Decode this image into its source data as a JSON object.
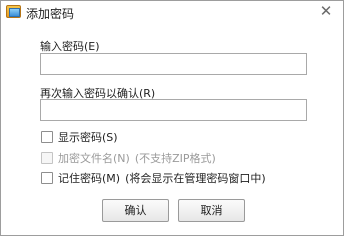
{
  "dialog": {
    "title": "添加密码",
    "close_glyph": "✕"
  },
  "form": {
    "password_label": "输入密码(E)",
    "password_value": "",
    "confirm_label": "再次输入密码以确认(R)",
    "confirm_value": "",
    "options": {
      "show_password": {
        "label": "显示密码(S)",
        "checked": false,
        "enabled": true
      },
      "encrypt_filenames": {
        "label": "加密文件名(N)",
        "note": "(不支持ZIP格式)",
        "checked": false,
        "enabled": false
      },
      "remember_password": {
        "label": "记住密码(M)",
        "note": "(将会显示在管理密码窗口中)",
        "checked": false,
        "enabled": true
      }
    }
  },
  "buttons": {
    "ok_label": "确认",
    "cancel_label": "取消"
  },
  "colors": {
    "border": "#9d9d9d",
    "disabled_text": "#9a9a9a"
  }
}
